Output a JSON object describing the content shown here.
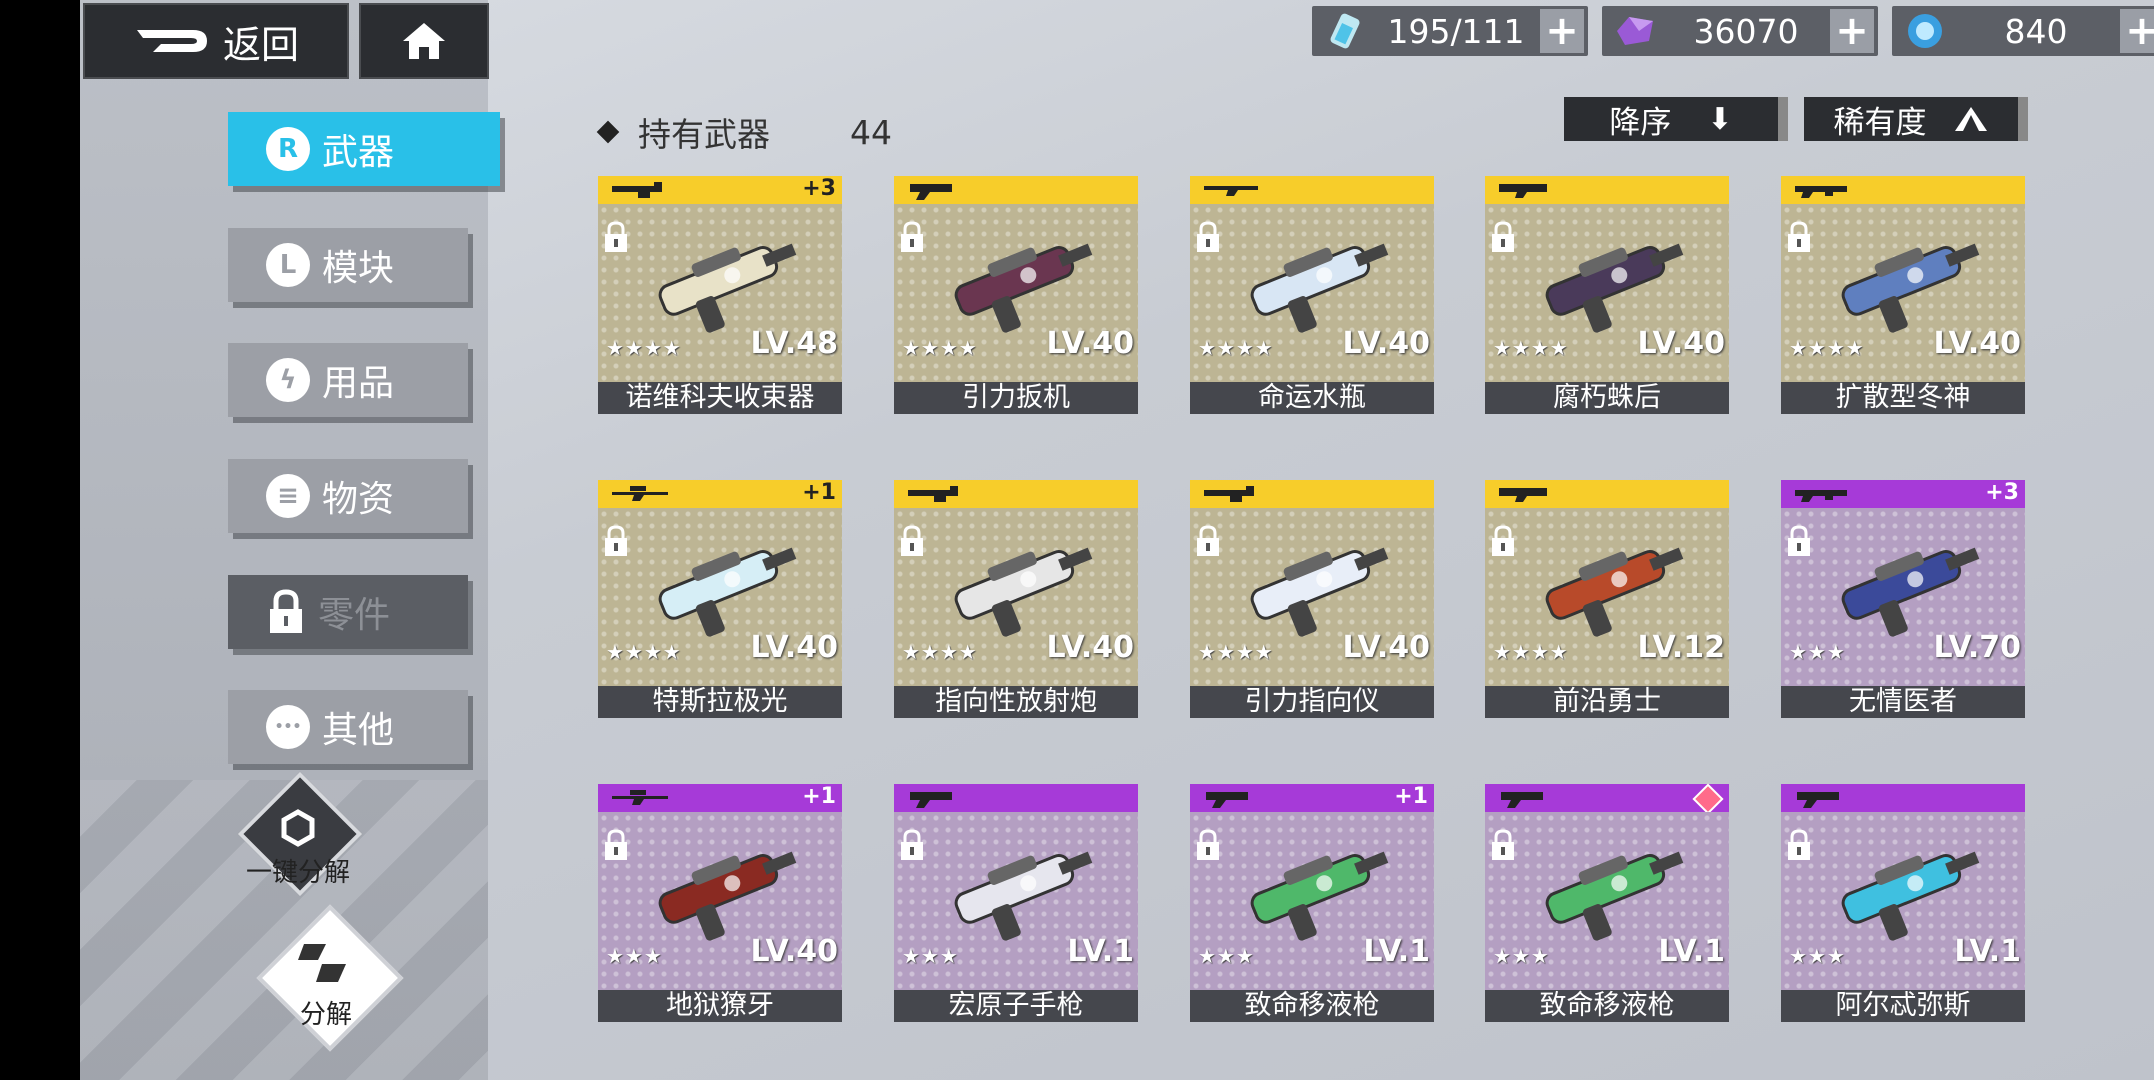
{
  "header": {
    "back_label": "返回"
  },
  "resources": [
    {
      "name": "stamina",
      "icon": "energy-vial-icon",
      "value": "195/111",
      "has_plus": true
    },
    {
      "name": "crystal",
      "icon": "purple-crystal-icon",
      "value": "36070",
      "has_plus": true
    },
    {
      "name": "orb",
      "icon": "blue-orb-icon",
      "value": "840",
      "has_plus": true
    }
  ],
  "tabs": [
    {
      "label": "武器",
      "icon": "weapon-tab-icon",
      "glyph": "R",
      "active": true
    },
    {
      "label": "模块",
      "icon": "module-tab-icon",
      "glyph": "L",
      "active": false
    },
    {
      "label": "用品",
      "icon": "lightning-icon",
      "glyph": "ϟ",
      "active": false
    },
    {
      "label": "物资",
      "icon": "supply-icon",
      "glyph": "≡",
      "active": false
    },
    {
      "label": "零件",
      "icon": "lock-icon",
      "glyph": "",
      "active": false,
      "locked": true
    },
    {
      "label": "其他",
      "icon": "ellipsis-icon",
      "glyph": "•••",
      "active": false
    }
  ],
  "actions": {
    "quick_dismantle": "一键分解",
    "dismantle": "分解"
  },
  "inventory": {
    "owned_label": "持有武器",
    "owned_count": "44"
  },
  "sort": {
    "order_label": "降序",
    "rarity_label": "稀有度"
  },
  "weapons": [
    {
      "name": "诺维科夫收束器",
      "level": "LV.48",
      "stars": "★★★★",
      "plus": "+3",
      "rarity": "gold",
      "type_icon": "heavy-gun-icon",
      "color": "#e8e2c8"
    },
    {
      "name": "引力扳机",
      "level": "LV.40",
      "stars": "★★★★",
      "plus": "",
      "rarity": "gold",
      "type_icon": "pistol-icon",
      "color": "#6a3650"
    },
    {
      "name": "命运水瓶",
      "level": "LV.40",
      "stars": "★★★★",
      "plus": "",
      "rarity": "gold",
      "type_icon": "rifle-icon",
      "color": "#d8e6f4"
    },
    {
      "name": "腐朽蛛后",
      "level": "LV.40",
      "stars": "★★★★",
      "plus": "",
      "rarity": "gold",
      "type_icon": "shotgun-icon",
      "color": "#4a3a5a"
    },
    {
      "name": "扩散型冬神",
      "level": "LV.40",
      "stars": "★★★★",
      "plus": "",
      "rarity": "gold",
      "type_icon": "assault-rifle-icon",
      "color": "#5f7fbf"
    },
    {
      "name": "特斯拉极光",
      "level": "LV.40",
      "stars": "★★★★",
      "plus": "+1",
      "rarity": "gold",
      "type_icon": "sniper-icon",
      "color": "#d6eef6"
    },
    {
      "name": "指向性放射炮",
      "level": "LV.40",
      "stars": "★★★★",
      "plus": "",
      "rarity": "gold",
      "type_icon": "heavy-gun-icon",
      "color": "#e6e6e6"
    },
    {
      "name": "引力指向仪",
      "level": "LV.40",
      "stars": "★★★★",
      "plus": "",
      "rarity": "gold",
      "type_icon": "heavy-gun-icon",
      "color": "#e8eef8"
    },
    {
      "name": "前沿勇士",
      "level": "LV.12",
      "stars": "★★★★",
      "plus": "",
      "rarity": "gold",
      "type_icon": "shotgun-icon",
      "color": "#b84a2a"
    },
    {
      "name": "无情医者",
      "level": "LV.70",
      "stars": "★★★",
      "plus": "+3",
      "rarity": "purple",
      "type_icon": "assault-rifle-icon",
      "color": "#3b4a9a"
    },
    {
      "name": "地狱獠牙",
      "level": "LV.40",
      "stars": "★★★",
      "plus": "+1",
      "rarity": "purple",
      "type_icon": "sniper-icon",
      "color": "#8a2a22"
    },
    {
      "name": "宏原子手枪",
      "level": "LV.1",
      "stars": "★★★",
      "plus": "",
      "rarity": "purple",
      "type_icon": "pistol-icon",
      "color": "#e6e6ee"
    },
    {
      "name": "致命移液枪",
      "level": "LV.1",
      "stars": "★★★",
      "plus": "+1",
      "rarity": "purple",
      "type_icon": "pistol-icon",
      "color": "#4fb86a"
    },
    {
      "name": "致命移液枪",
      "level": "LV.1",
      "stars": "★★★",
      "plus": "",
      "rarity": "purple",
      "type_icon": "pistol-icon",
      "color": "#4fb86a",
      "gem": true
    },
    {
      "name": "阿尔忒弥斯",
      "level": "LV.1",
      "stars": "★★★",
      "plus": "",
      "rarity": "purple",
      "type_icon": "pistol-icon",
      "color": "#3fc0e0"
    }
  ]
}
